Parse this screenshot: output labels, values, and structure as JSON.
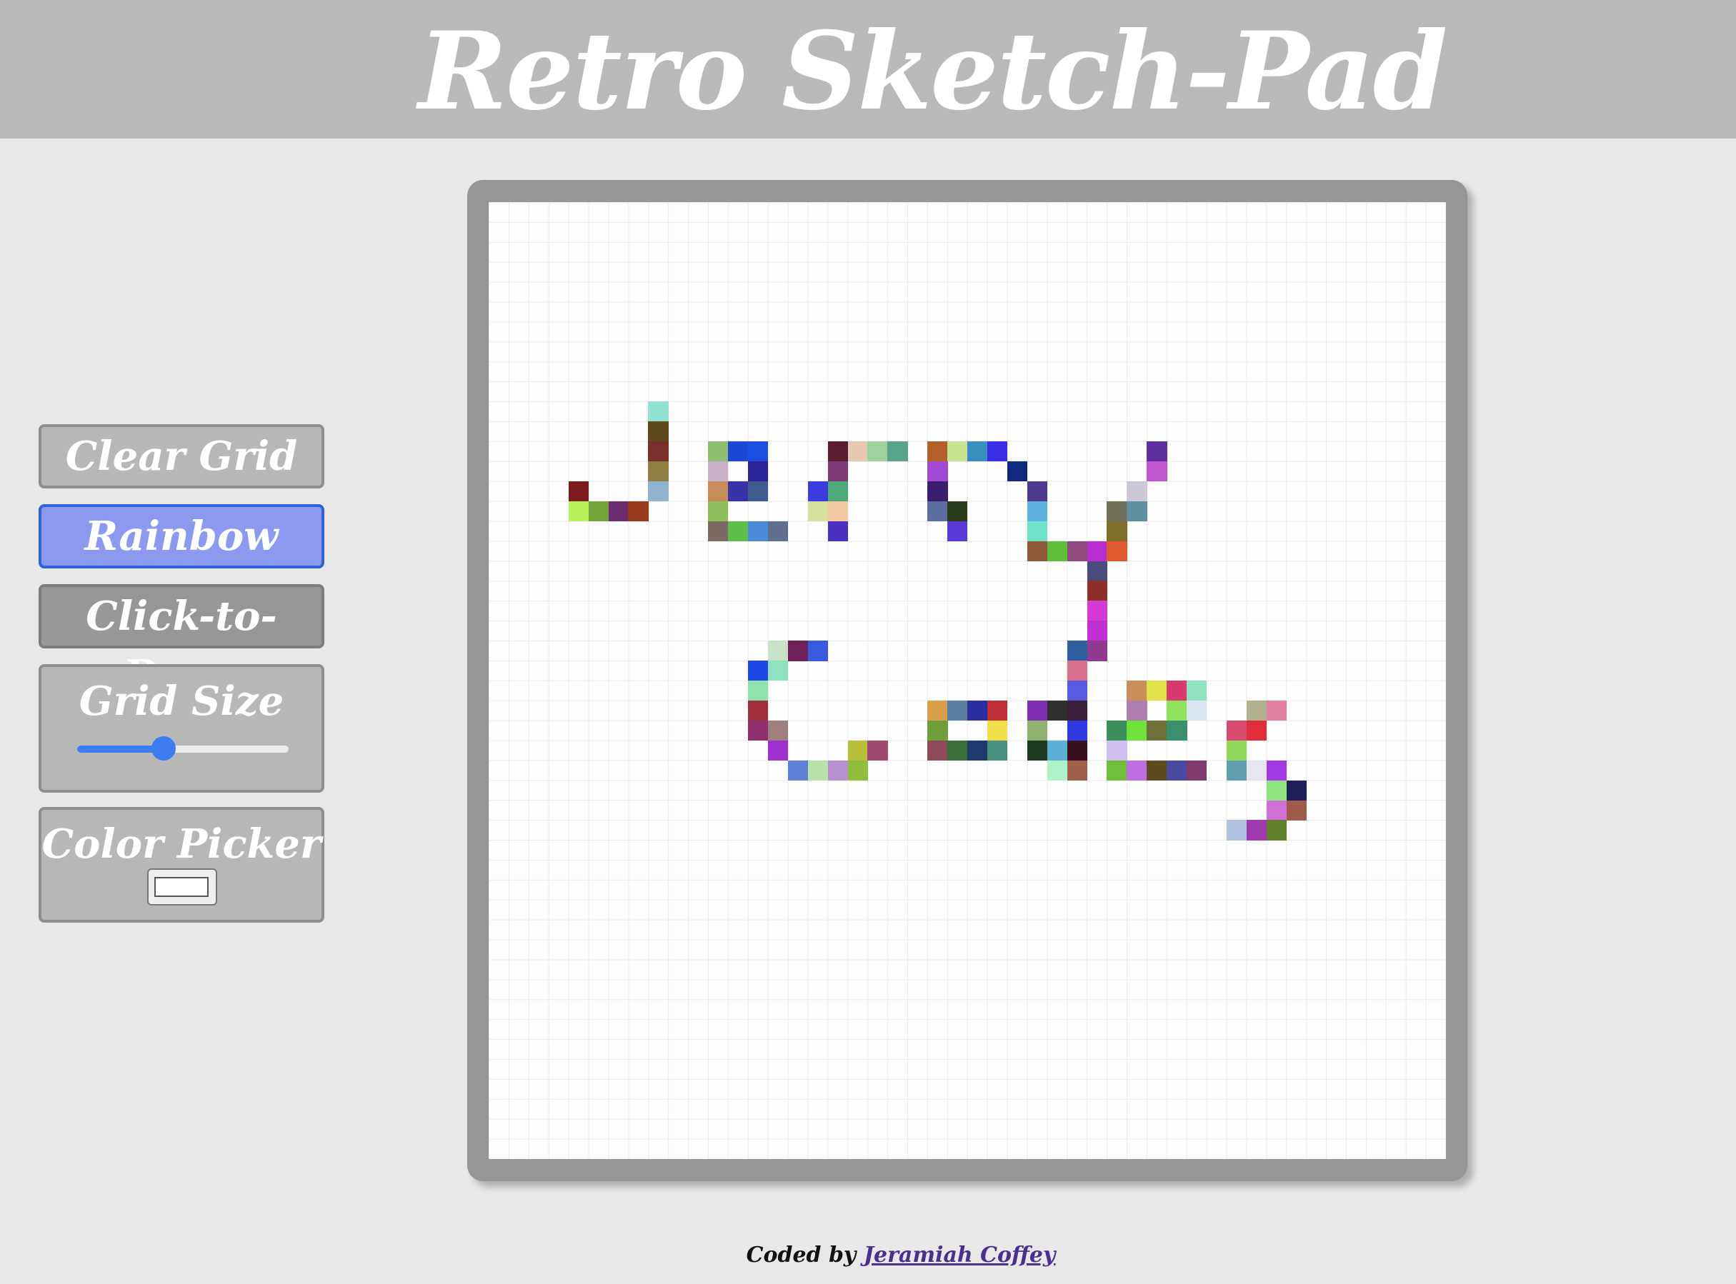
{
  "header": {
    "title": "Retro Sketch-Pad"
  },
  "controls": {
    "clear_label": "Clear Grid",
    "rainbow_label": "Rainbow",
    "click_label": "Click-to-Draw",
    "grid_size_label": "Grid Size",
    "grid_size_value_fraction": 0.41,
    "color_picker_label": "Color Picker",
    "color_value": "#ffffff"
  },
  "colors": {
    "header_bg": "#b9b9b9",
    "button_bg": "#b7b7b7",
    "rainbow_active_bg": "#8b99ef",
    "slider_accent": "#3d7bf0"
  },
  "grid": {
    "size": 48,
    "cells": [
      [
        10,
        8,
        "#8fe2d2"
      ],
      [
        11,
        8,
        "#5e4a1c"
      ],
      [
        12,
        8,
        "#7a2f2a"
      ],
      [
        13,
        8,
        "#8f7f42"
      ],
      [
        14,
        8,
        "#90b3d0"
      ],
      [
        14,
        4,
        "#7d1a1e"
      ],
      [
        15,
        4,
        "#b8f25a"
      ],
      [
        15,
        5,
        "#72a43a"
      ],
      [
        15,
        6,
        "#6b2d70"
      ],
      [
        15,
        7,
        "#9a3a1c"
      ],
      [
        12,
        11,
        "#8dbf6f"
      ],
      [
        12,
        12,
        "#1f47d6"
      ],
      [
        12,
        13,
        "#1c4fe0"
      ],
      [
        13,
        11,
        "#c7b2c8"
      ],
      [
        13,
        13,
        "#2a2497"
      ],
      [
        14,
        11,
        "#c78c5c"
      ],
      [
        14,
        12,
        "#3834a8"
      ],
      [
        14,
        13,
        "#3f5b8f"
      ],
      [
        15,
        11,
        "#8fbf5c"
      ],
      [
        16,
        11,
        "#7d6a64"
      ],
      [
        16,
        12,
        "#5cbf4a"
      ],
      [
        16,
        13,
        "#4a8ad6"
      ],
      [
        16,
        14,
        "#5f6f8f"
      ],
      [
        12,
        17,
        "#5a1c2f"
      ],
      [
        12,
        18,
        "#e6c8b0"
      ],
      [
        12,
        19,
        "#9fd0a0"
      ],
      [
        12,
        20,
        "#5aa58a"
      ],
      [
        13,
        17,
        "#7f3a7a"
      ],
      [
        14,
        16,
        "#3c3cdf"
      ],
      [
        14,
        17,
        "#4ea87a"
      ],
      [
        15,
        16,
        "#d6dfa0"
      ],
      [
        15,
        17,
        "#f2c8a0"
      ],
      [
        16,
        17,
        "#4a2fc0"
      ],
      [
        12,
        22,
        "#b25f2a"
      ],
      [
        12,
        23,
        "#c8e28f"
      ],
      [
        12,
        24,
        "#3a8fc0"
      ],
      [
        12,
        25,
        "#3a2fe6"
      ],
      [
        13,
        22,
        "#a24ad6"
      ],
      [
        13,
        26,
        "#102a7f"
      ],
      [
        14,
        22,
        "#3a1f6f"
      ],
      [
        14,
        27,
        "#4f3a8f"
      ],
      [
        15,
        22,
        "#5a6fa0"
      ],
      [
        15,
        23,
        "#2a3a1c"
      ],
      [
        15,
        27,
        "#5fb2e0"
      ],
      [
        16,
        23,
        "#5a3ad6"
      ],
      [
        16,
        27,
        "#6fe2c8"
      ],
      [
        12,
        33,
        "#5f2fa0"
      ],
      [
        13,
        33,
        "#c056d0"
      ],
      [
        14,
        32,
        "#ccc8d8"
      ],
      [
        15,
        31,
        "#6f6f5a"
      ],
      [
        15,
        32,
        "#5f8fa0"
      ],
      [
        16,
        31,
        "#7f6f2a"
      ],
      [
        17,
        27,
        "#8f5a3a"
      ],
      [
        17,
        28,
        "#5fbf3a"
      ],
      [
        17,
        29,
        "#8f4a7f"
      ],
      [
        17,
        30,
        "#b82fcf"
      ],
      [
        17,
        31,
        "#e05a2f"
      ],
      [
        18,
        30,
        "#4a4a7f"
      ],
      [
        19,
        30,
        "#8f2f2a"
      ],
      [
        20,
        30,
        "#d63ad6"
      ],
      [
        21,
        30,
        "#c02fcf"
      ],
      [
        22,
        29,
        "#2f5fa0"
      ],
      [
        22,
        30,
        "#8f3a8f"
      ],
      [
        23,
        29,
        "#d86f8f"
      ],
      [
        24,
        29,
        "#5a5ae0"
      ],
      [
        22,
        14,
        "#c8e2c8"
      ],
      [
        22,
        15,
        "#6f1f5a"
      ],
      [
        22,
        16,
        "#3a5ae0"
      ],
      [
        23,
        13,
        "#1f47e6"
      ],
      [
        23,
        14,
        "#8fe2c0"
      ],
      [
        24,
        13,
        "#8fe2b0"
      ],
      [
        25,
        13,
        "#a02f3a"
      ],
      [
        26,
        13,
        "#8f2f6f"
      ],
      [
        26,
        14,
        "#a07f7f"
      ],
      [
        27,
        14,
        "#a02fcf"
      ],
      [
        28,
        15,
        "#5f7fd6"
      ],
      [
        28,
        16,
        "#b8e2a8"
      ],
      [
        28,
        17,
        "#b88fcf"
      ],
      [
        28,
        18,
        "#8fbf3a"
      ],
      [
        27,
        18,
        "#b8bf3a"
      ],
      [
        27,
        19,
        "#a04a6f"
      ],
      [
        25,
        22,
        "#d8a04a"
      ],
      [
        25,
        23,
        "#5a7fa0"
      ],
      [
        25,
        24,
        "#2a2fa0"
      ],
      [
        25,
        25,
        "#c02f3a"
      ],
      [
        26,
        22,
        "#6f9f3a"
      ],
      [
        26,
        25,
        "#f2e04a"
      ],
      [
        27,
        22,
        "#8f4a5a"
      ],
      [
        27,
        23,
        "#3a6f3a"
      ],
      [
        27,
        24,
        "#1f3a6f"
      ],
      [
        27,
        25,
        "#4a8f7f"
      ],
      [
        25,
        27,
        "#7f2fb0"
      ],
      [
        25,
        28,
        "#2f2f2f"
      ],
      [
        25,
        29,
        "#3a1f3a"
      ],
      [
        26,
        27,
        "#8fb06f"
      ],
      [
        26,
        29,
        "#2f3ae0"
      ],
      [
        27,
        27,
        "#1f3a1f"
      ],
      [
        27,
        28,
        "#5fb0d6"
      ],
      [
        27,
        29,
        "#3a0f1f"
      ],
      [
        28,
        28,
        "#b0f2c8"
      ],
      [
        28,
        29,
        "#a0604a"
      ],
      [
        24,
        32,
        "#c88f5a"
      ],
      [
        24,
        33,
        "#e2e24a"
      ],
      [
        24,
        34,
        "#d83a6f"
      ],
      [
        24,
        35,
        "#8fe2c0"
      ],
      [
        25,
        32,
        "#b07fb0"
      ],
      [
        25,
        34,
        "#8fe25a"
      ],
      [
        25,
        35,
        "#d8e6f0"
      ],
      [
        26,
        31,
        "#3a8f5a"
      ],
      [
        26,
        32,
        "#6fe23a"
      ],
      [
        26,
        33,
        "#6f6f3a"
      ],
      [
        26,
        34,
        "#3a8f6f"
      ],
      [
        27,
        31,
        "#d0c0f0"
      ],
      [
        28,
        31,
        "#6fbf3a"
      ],
      [
        28,
        32,
        "#c06fe2"
      ],
      [
        28,
        33,
        "#5f4a1f"
      ],
      [
        28,
        34,
        "#4a4aa0"
      ],
      [
        28,
        35,
        "#7f3a6f"
      ],
      [
        25,
        38,
        "#b0b08f"
      ],
      [
        25,
        39,
        "#e07f9f"
      ],
      [
        26,
        37,
        "#d84a6f"
      ],
      [
        26,
        38,
        "#e02f3a"
      ],
      [
        27,
        37,
        "#8fd65a"
      ],
      [
        28,
        37,
        "#5f9fb0"
      ],
      [
        28,
        38,
        "#e6e6f0"
      ],
      [
        28,
        39,
        "#a03ae0"
      ],
      [
        29,
        39,
        "#8fe27f"
      ],
      [
        29,
        40,
        "#1f1f5a"
      ],
      [
        30,
        39,
        "#d06fd6"
      ],
      [
        30,
        40,
        "#a05a4a"
      ],
      [
        31,
        37,
        "#b0c0e0"
      ],
      [
        31,
        38,
        "#a03ab0"
      ],
      [
        31,
        39,
        "#5f7f2a"
      ]
    ]
  },
  "footer": {
    "prefix": "Coded by ",
    "author": "Jeramiah Coffey"
  }
}
